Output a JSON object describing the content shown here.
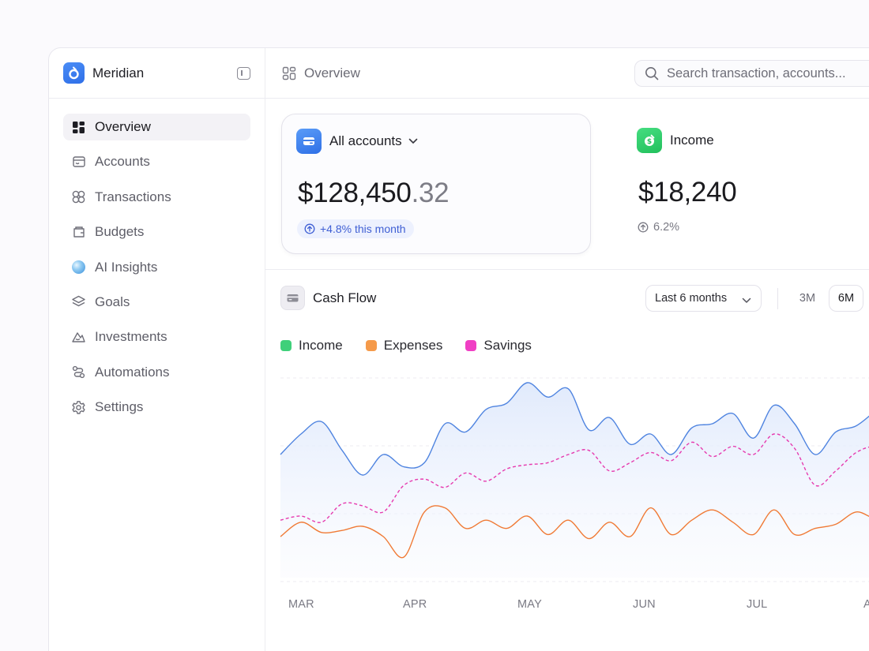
{
  "app": {
    "name": "Meridian"
  },
  "sidebar": {
    "items": [
      {
        "label": "Overview",
        "icon": "dashboard-grid-icon",
        "active": true
      },
      {
        "label": "Accounts",
        "icon": "wallet-icon"
      },
      {
        "label": "Transactions",
        "icon": "transactions-icon"
      },
      {
        "label": "Budgets",
        "icon": "budget-icon"
      },
      {
        "label": "AI Insights",
        "icon": "ai-orb-icon"
      },
      {
        "label": "Goals",
        "icon": "goals-layers-icon"
      },
      {
        "label": "Investments",
        "icon": "investments-icon"
      },
      {
        "label": "Automations",
        "icon": "automations-icon"
      },
      {
        "label": "Settings",
        "icon": "settings-gear-icon"
      }
    ]
  },
  "header": {
    "breadcrumb": "Overview",
    "search_placeholder": "Search transaction, accounts..."
  },
  "accounts_card": {
    "title": "All accounts",
    "amount_main": "$128,450",
    "amount_cents": ".32",
    "change": "+4.8% this month"
  },
  "income_card": {
    "title": "Income",
    "amount": "$18,240",
    "change": "6.2%"
  },
  "cashflow": {
    "title": "Cash Flow",
    "range": "Last 6 months",
    "segments": [
      "3M",
      "6M"
    ],
    "active_segment": "6M",
    "legend": [
      {
        "name": "Income",
        "color": "#3fd07a"
      },
      {
        "name": "Expenses",
        "color": "#f59a4a"
      },
      {
        "name": "Savings",
        "color": "#f03fc4"
      }
    ]
  },
  "colors": {
    "accent": "#2f6fe8",
    "income_line": "#4f84e0",
    "expenses_line": "#f07a35",
    "savings_line": "#e63aaf",
    "positive_pill_text": "#3f5fd4"
  },
  "chart_data": {
    "type": "area",
    "x_labels": [
      "MAR",
      "APR",
      "MAY",
      "JUN",
      "JUL",
      "A"
    ],
    "grid": true,
    "series": [
      {
        "name": "Income",
        "style": "area",
        "values": [
          60,
          70,
          76,
          62,
          50,
          60,
          54,
          56,
          75,
          71,
          82,
          85,
          95,
          88,
          92,
          72,
          78,
          65,
          70,
          60,
          73,
          75,
          80,
          68,
          84,
          75,
          60,
          71,
          74,
          82,
          91
        ]
      },
      {
        "name": "Expenses",
        "style": "line",
        "values": [
          20,
          27,
          22,
          23,
          25,
          20,
          10,
          32,
          34,
          24,
          28,
          24,
          30,
          21,
          28,
          19,
          27,
          20,
          34,
          21,
          28,
          33,
          27,
          21,
          33,
          21,
          24,
          26,
          32,
          29,
          35
        ]
      },
      {
        "name": "Savings",
        "style": "dashed",
        "values": [
          28,
          30,
          27,
          36,
          35,
          32,
          45,
          48,
          44,
          51,
          47,
          53,
          55,
          56,
          60,
          62,
          52,
          56,
          61,
          57,
          66,
          59,
          64,
          60,
          70,
          63,
          45,
          52,
          61,
          64,
          60
        ]
      }
    ]
  }
}
